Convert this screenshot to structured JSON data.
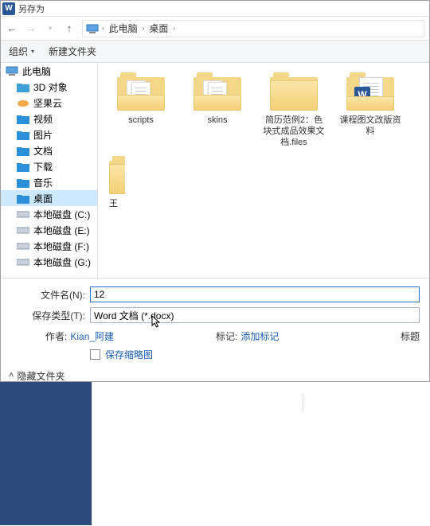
{
  "title": "另存为",
  "nav": {
    "pc": "此电脑",
    "desktop": "桌面"
  },
  "toolbar": {
    "organize": "组织",
    "newfolder": "新建文件夹"
  },
  "tree": {
    "pc": "此电脑",
    "d3d": "3D 对象",
    "jianguo": "坚果云",
    "video": "视频",
    "pictures": "图片",
    "documents": "文档",
    "download": "下载",
    "music": "音乐",
    "desktop": "桌面",
    "diskC": "本地磁盘 (C:)",
    "diskE": "本地磁盘 (E:)",
    "diskF": "本地磁盘 (F:)",
    "diskG": "本地磁盘 (G:)"
  },
  "files": {
    "scripts": "scripts",
    "skins": "skins",
    "resume": "简历范例2：色块式成品效果文档.files",
    "course": "课程图文改版资料",
    "partial": "王"
  },
  "form": {
    "filename_label": "文件名(N):",
    "filename_value": "12",
    "type_label": "保存类型(T):",
    "type_value": "Word 文档 (*.docx)",
    "author_label": "作者:",
    "author_value": "Kian_阿建",
    "tag_label": "标记:",
    "tag_value": "添加标记",
    "title_label": "标题",
    "thumb_label": "保存缩略图"
  },
  "bottom": {
    "hide": "隐藏文件夹"
  }
}
